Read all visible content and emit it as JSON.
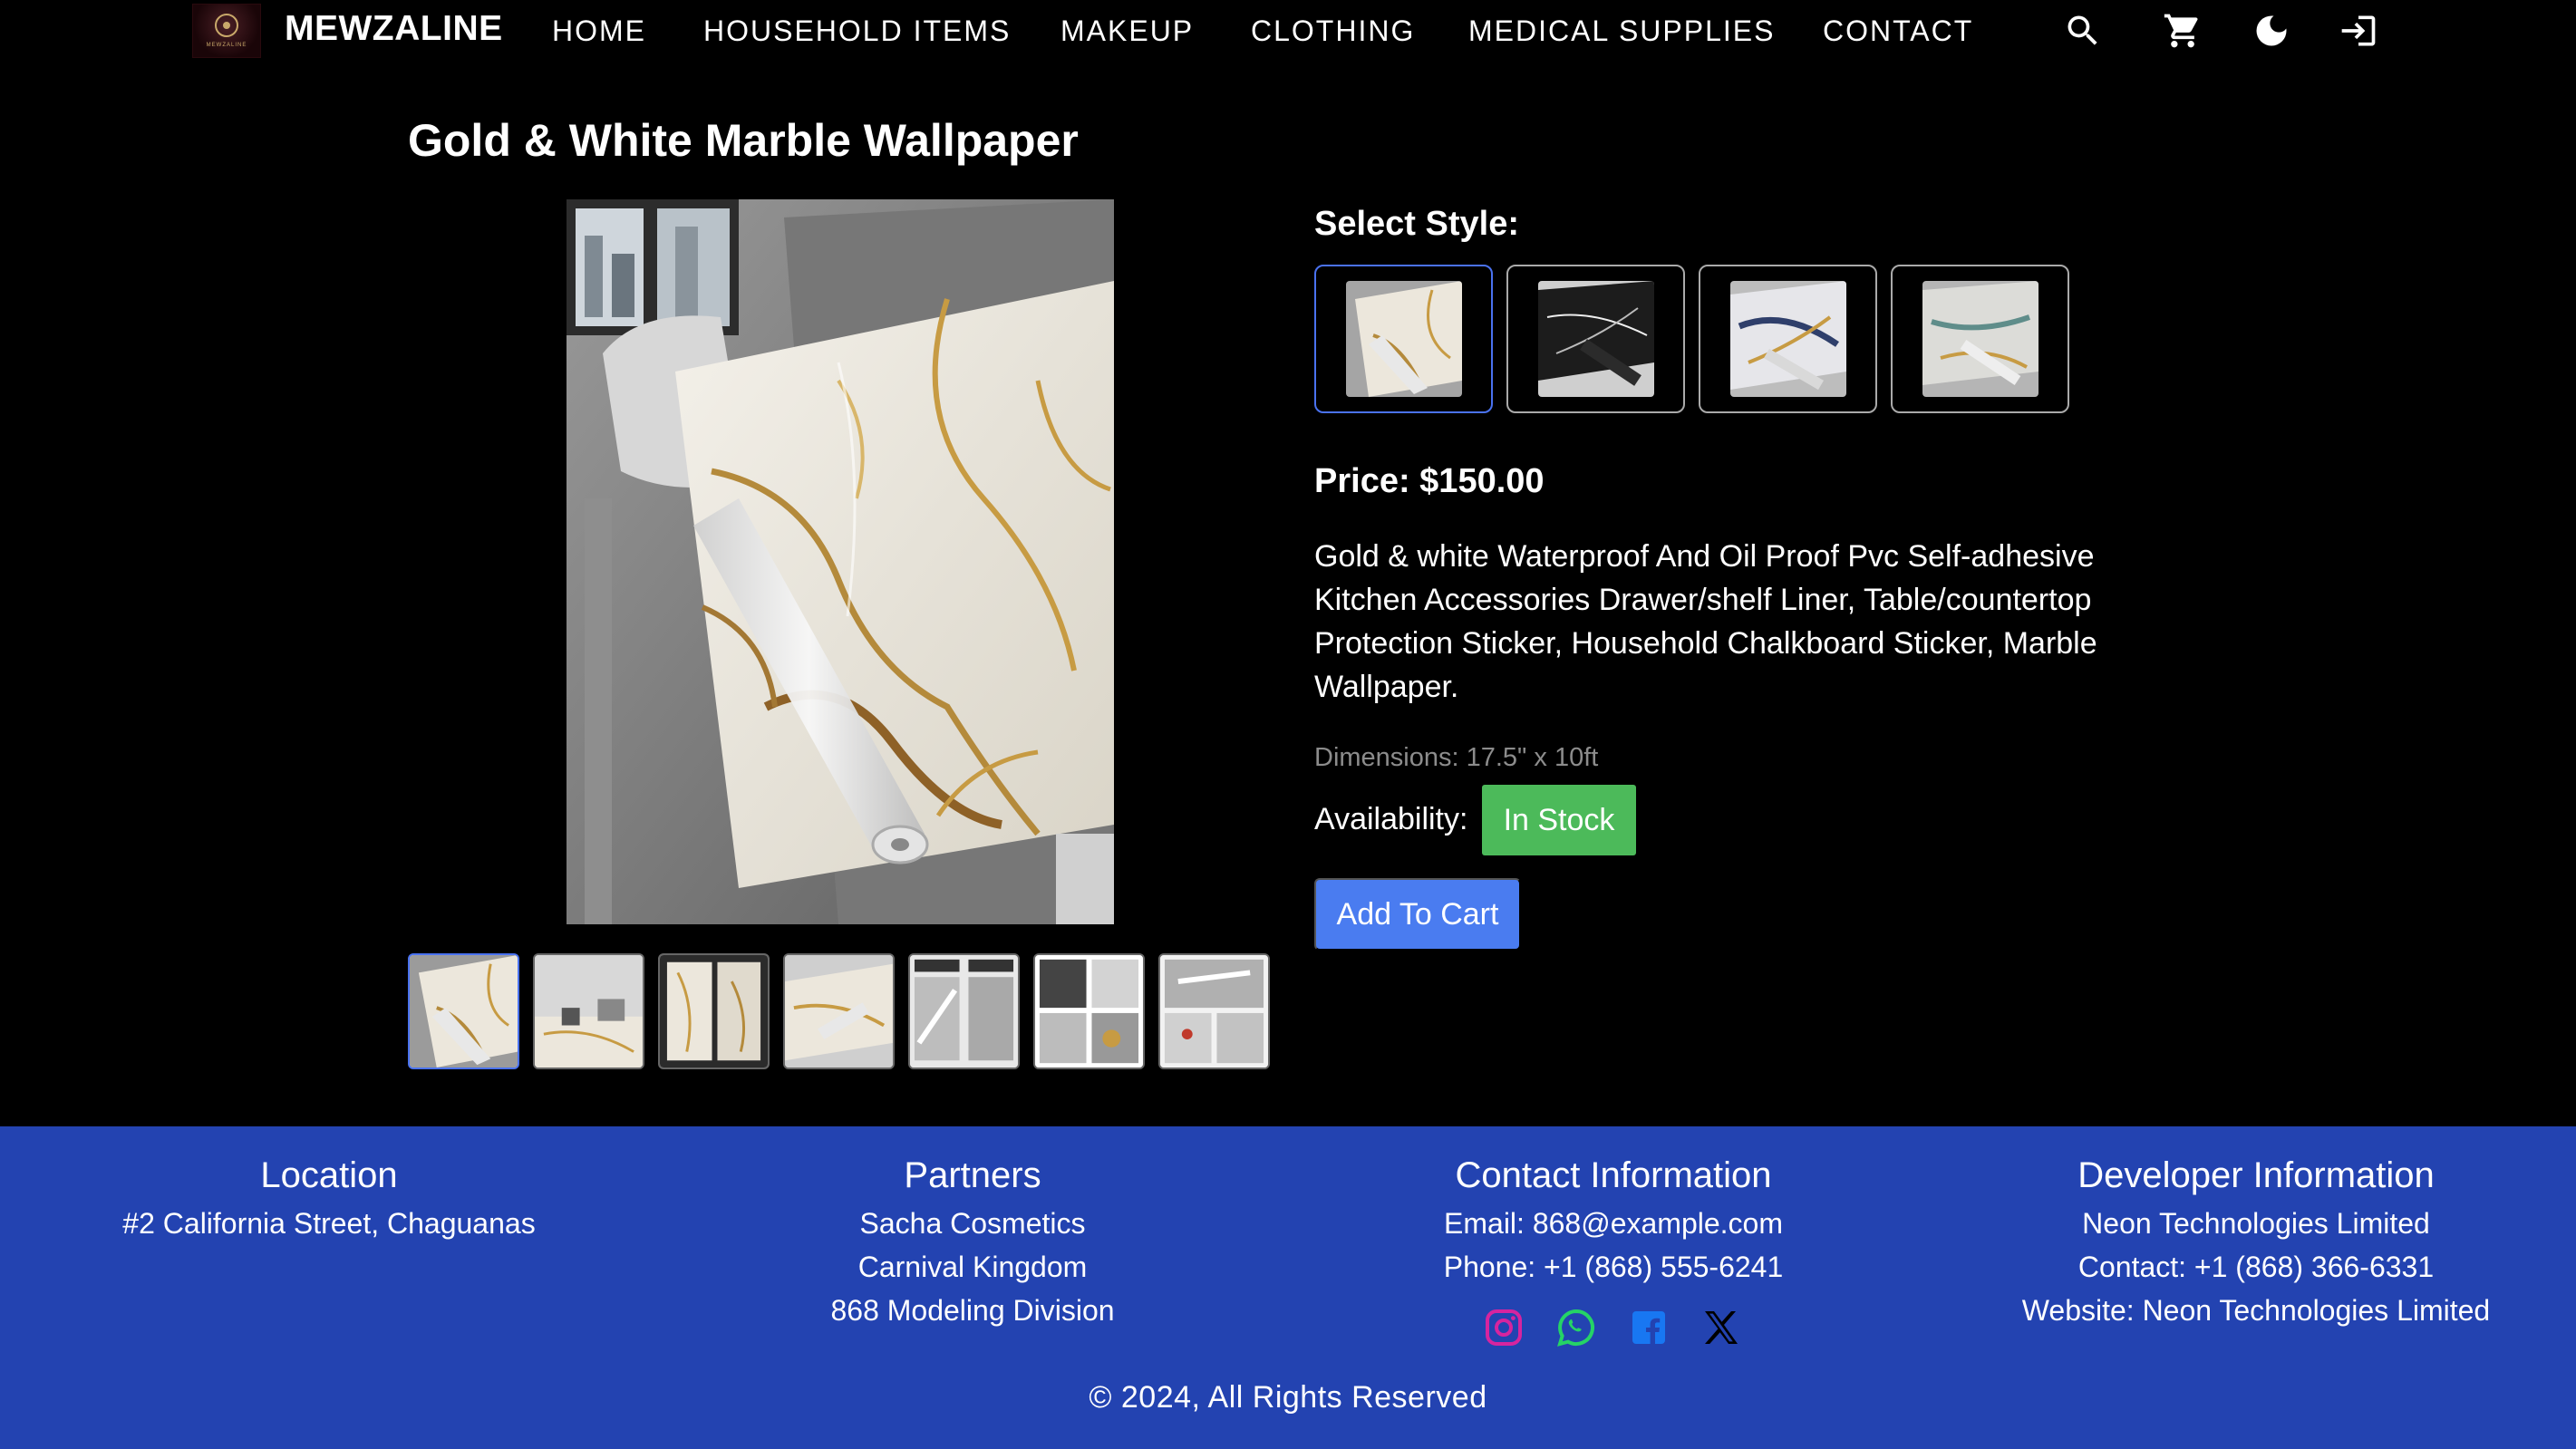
{
  "nav": {
    "brand": "MEWZALINE",
    "logo_text": "MEWZALINE",
    "links": [
      "HOME",
      "HOUSEHOLD ITEMS",
      "MAKEUP",
      "CLOTHING",
      "MEDICAL SUPPLIES",
      "CONTACT"
    ],
    "icons": [
      "search-icon",
      "cart-icon",
      "dark-mode-icon",
      "login-icon"
    ]
  },
  "product": {
    "title": "Gold & White Marble Wallpaper",
    "select_style_label": "Select Style:",
    "styles": [
      "gold-white-marble",
      "black-marble",
      "blue-gold-marble",
      "grey-teal-marble"
    ],
    "selected_style": 0,
    "thumbnail_count": 7,
    "selected_thumbnail": 0,
    "price": "Price: $150.00",
    "description": "Gold & white Waterproof And Oil Proof Pvc Self-adhesive Kitchen Accessories Drawer/shelf Liner, Table/countertop Protection Sticker, Household Chalkboard Sticker, Marble Wallpaper.",
    "dimensions": "Dimensions: 17.5\" x 10ft",
    "availability_label": "Availability:",
    "availability_status": "In Stock",
    "add_to_cart": "Add To Cart"
  },
  "footer": {
    "location": {
      "heading": "Location",
      "lines": [
        "#2 California Street, Chaguanas"
      ]
    },
    "partners": {
      "heading": "Partners",
      "lines": [
        "Sacha Cosmetics",
        "Carnival Kingdom",
        "868 Modeling Division"
      ]
    },
    "contact": {
      "heading": "Contact Information",
      "lines": [
        "Email: 868@example.com",
        "Phone: +1 (868) 555-6241"
      ]
    },
    "developer": {
      "heading": "Developer Information",
      "lines": [
        "Neon Technologies Limited",
        "Contact: +1 (868) 366-6331",
        "Website: Neon Technologies Limited"
      ]
    },
    "socials": [
      "instagram-icon",
      "whatsapp-icon",
      "facebook-icon",
      "x-icon"
    ],
    "copyright": "© 2024, All Rights Reserved"
  },
  "colors": {
    "background": "#000000",
    "footer_bg": "#2343b1",
    "accent_blue": "#4a7cf0",
    "in_stock_green": "#4cba5a",
    "instagram": "#d6249f",
    "whatsapp": "#25d366",
    "facebook": "#1877f2"
  }
}
